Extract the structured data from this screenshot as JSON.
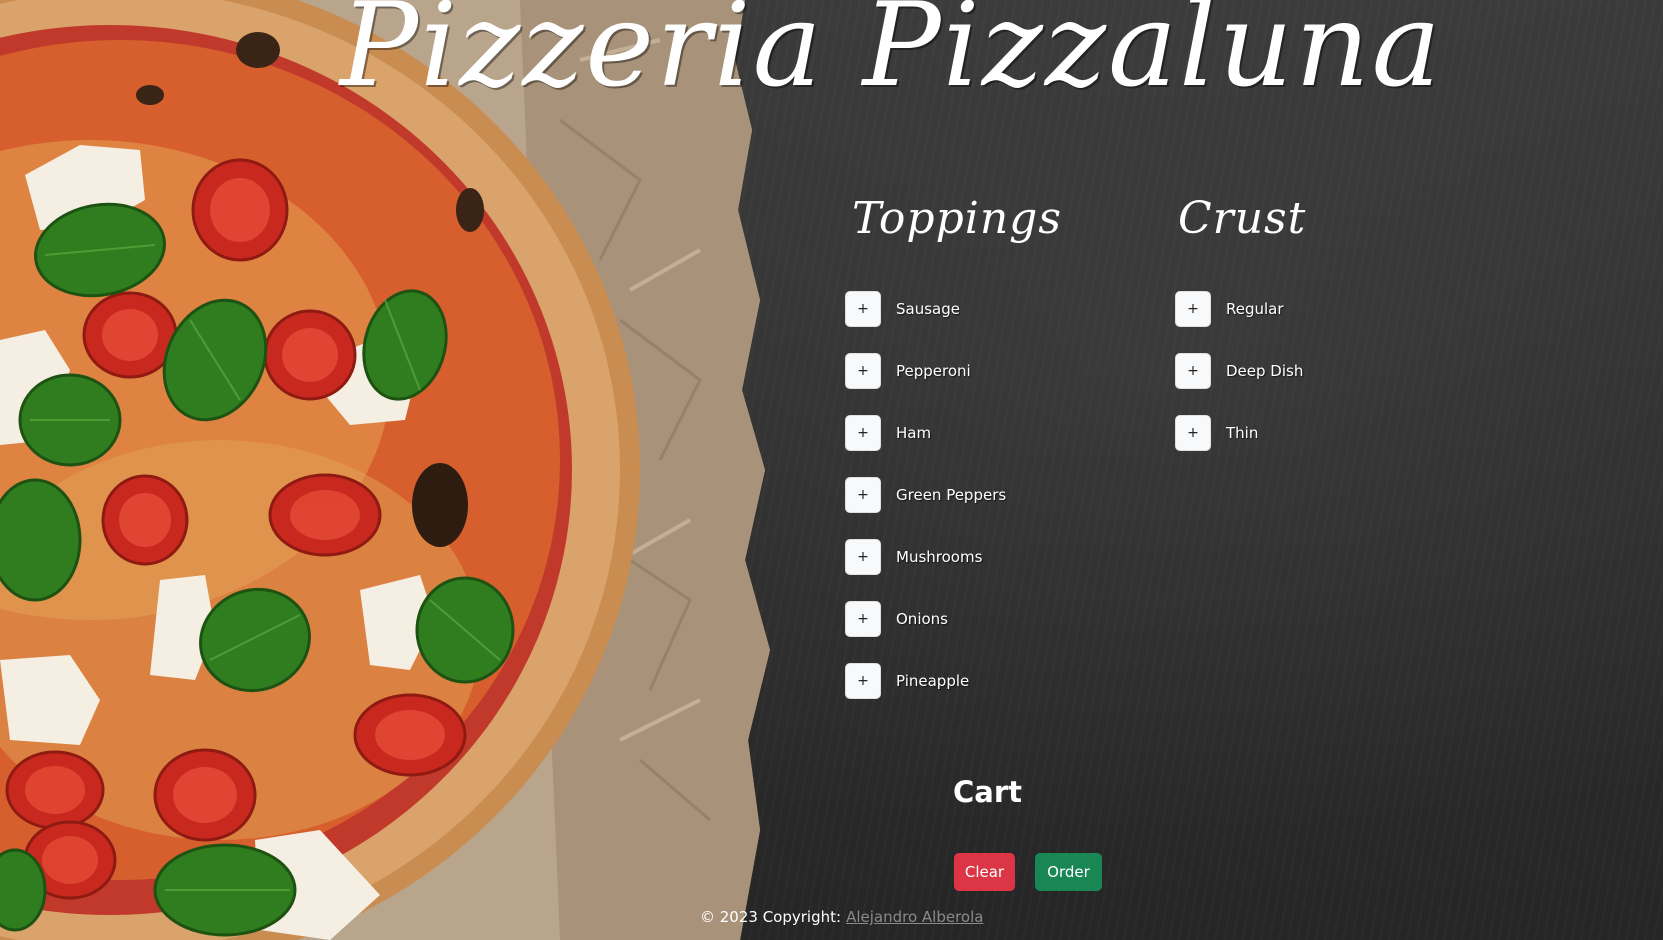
{
  "title": "Pizzeria  Pizzaluna",
  "toppings": {
    "heading": "Toppings",
    "items": [
      {
        "label": "Sausage",
        "button": "+"
      },
      {
        "label": "Pepperoni",
        "button": "+"
      },
      {
        "label": "Ham",
        "button": "+"
      },
      {
        "label": "Green Peppers",
        "button": "+"
      },
      {
        "label": "Mushrooms",
        "button": "+"
      },
      {
        "label": "Onions",
        "button": "+"
      },
      {
        "label": "Pineapple",
        "button": "+"
      }
    ]
  },
  "crust": {
    "heading": "Crust",
    "items": [
      {
        "label": "Regular",
        "button": "+"
      },
      {
        "label": "Deep Dish",
        "button": "+"
      },
      {
        "label": "Thin",
        "button": "+"
      }
    ]
  },
  "cart": {
    "heading": "Cart",
    "clear_label": "Clear",
    "order_label": "Order"
  },
  "footer": {
    "copyright": "© 2023 Copyright:",
    "author": "Alejandro Alberola"
  },
  "colors": {
    "clear": "#dc3545",
    "order": "#198754",
    "background": "#2d2d2d"
  }
}
